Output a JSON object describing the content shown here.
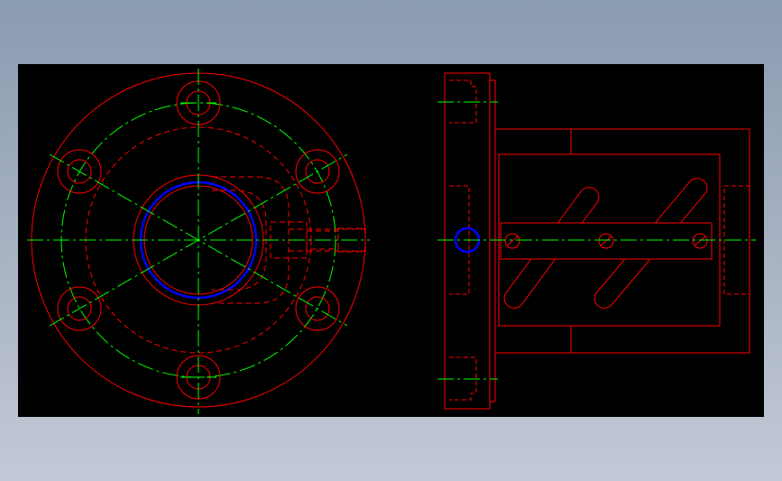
{
  "colors": {
    "background_gradient_top": "#8a9bb0",
    "background_gradient_bottom": "#c3c9d6",
    "viewport_background": "#000000",
    "outline": "#ff0000",
    "hidden_line": "#ff0000",
    "centerline": "#00ff00",
    "highlight_circle": "#0000ff"
  },
  "views": [
    {
      "name": "front-view",
      "description_visible": false
    },
    {
      "name": "side-view",
      "description_visible": false
    }
  ],
  "line_styles": {
    "outline": "solid",
    "hidden": "dashed",
    "center": "dash-dot"
  }
}
